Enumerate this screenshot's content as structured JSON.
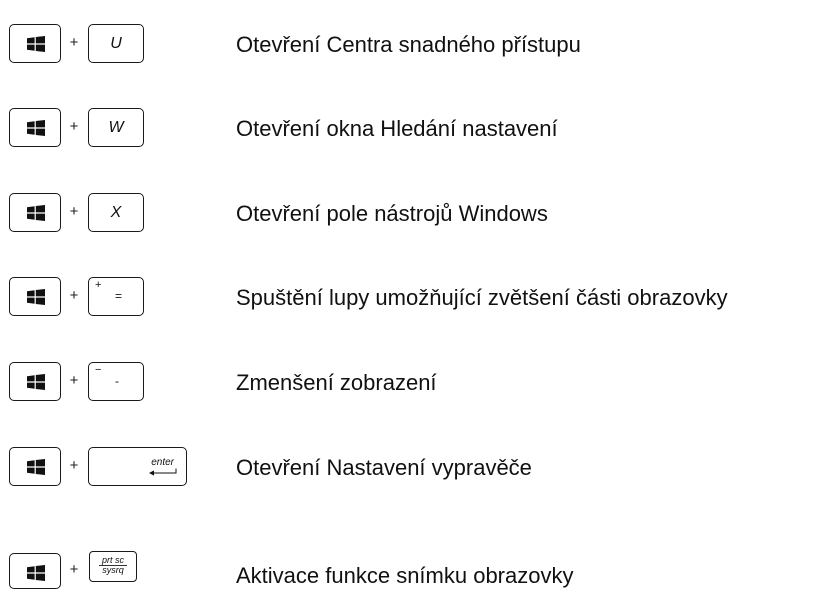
{
  "shortcuts": [
    {
      "key": "U",
      "description": "Otevření Centra snadného přístupu"
    },
    {
      "key": "W",
      "description": "Otevření okna Hledání nastavení"
    },
    {
      "key": "X",
      "description": "Otevření pole nástrojů Windows"
    },
    {
      "key_top": "+",
      "key_main": "=",
      "description": "Spuštění lupy umožňující zvětšení části obrazovky"
    },
    {
      "key_top": "−",
      "key_main": "-",
      "description": "Zmenšení zobrazení"
    },
    {
      "key": "enter",
      "description": "Otevření Nastavení vypravěče"
    },
    {
      "key_top": "prt sc",
      "key_bottom": "sysrq",
      "description": "Aktivace funkce snímku obrazovky"
    }
  ],
  "plus_sign": "+",
  "icons": {
    "windows_key": "windows-logo-icon",
    "enter_arrow": "enter-arrow-icon"
  }
}
